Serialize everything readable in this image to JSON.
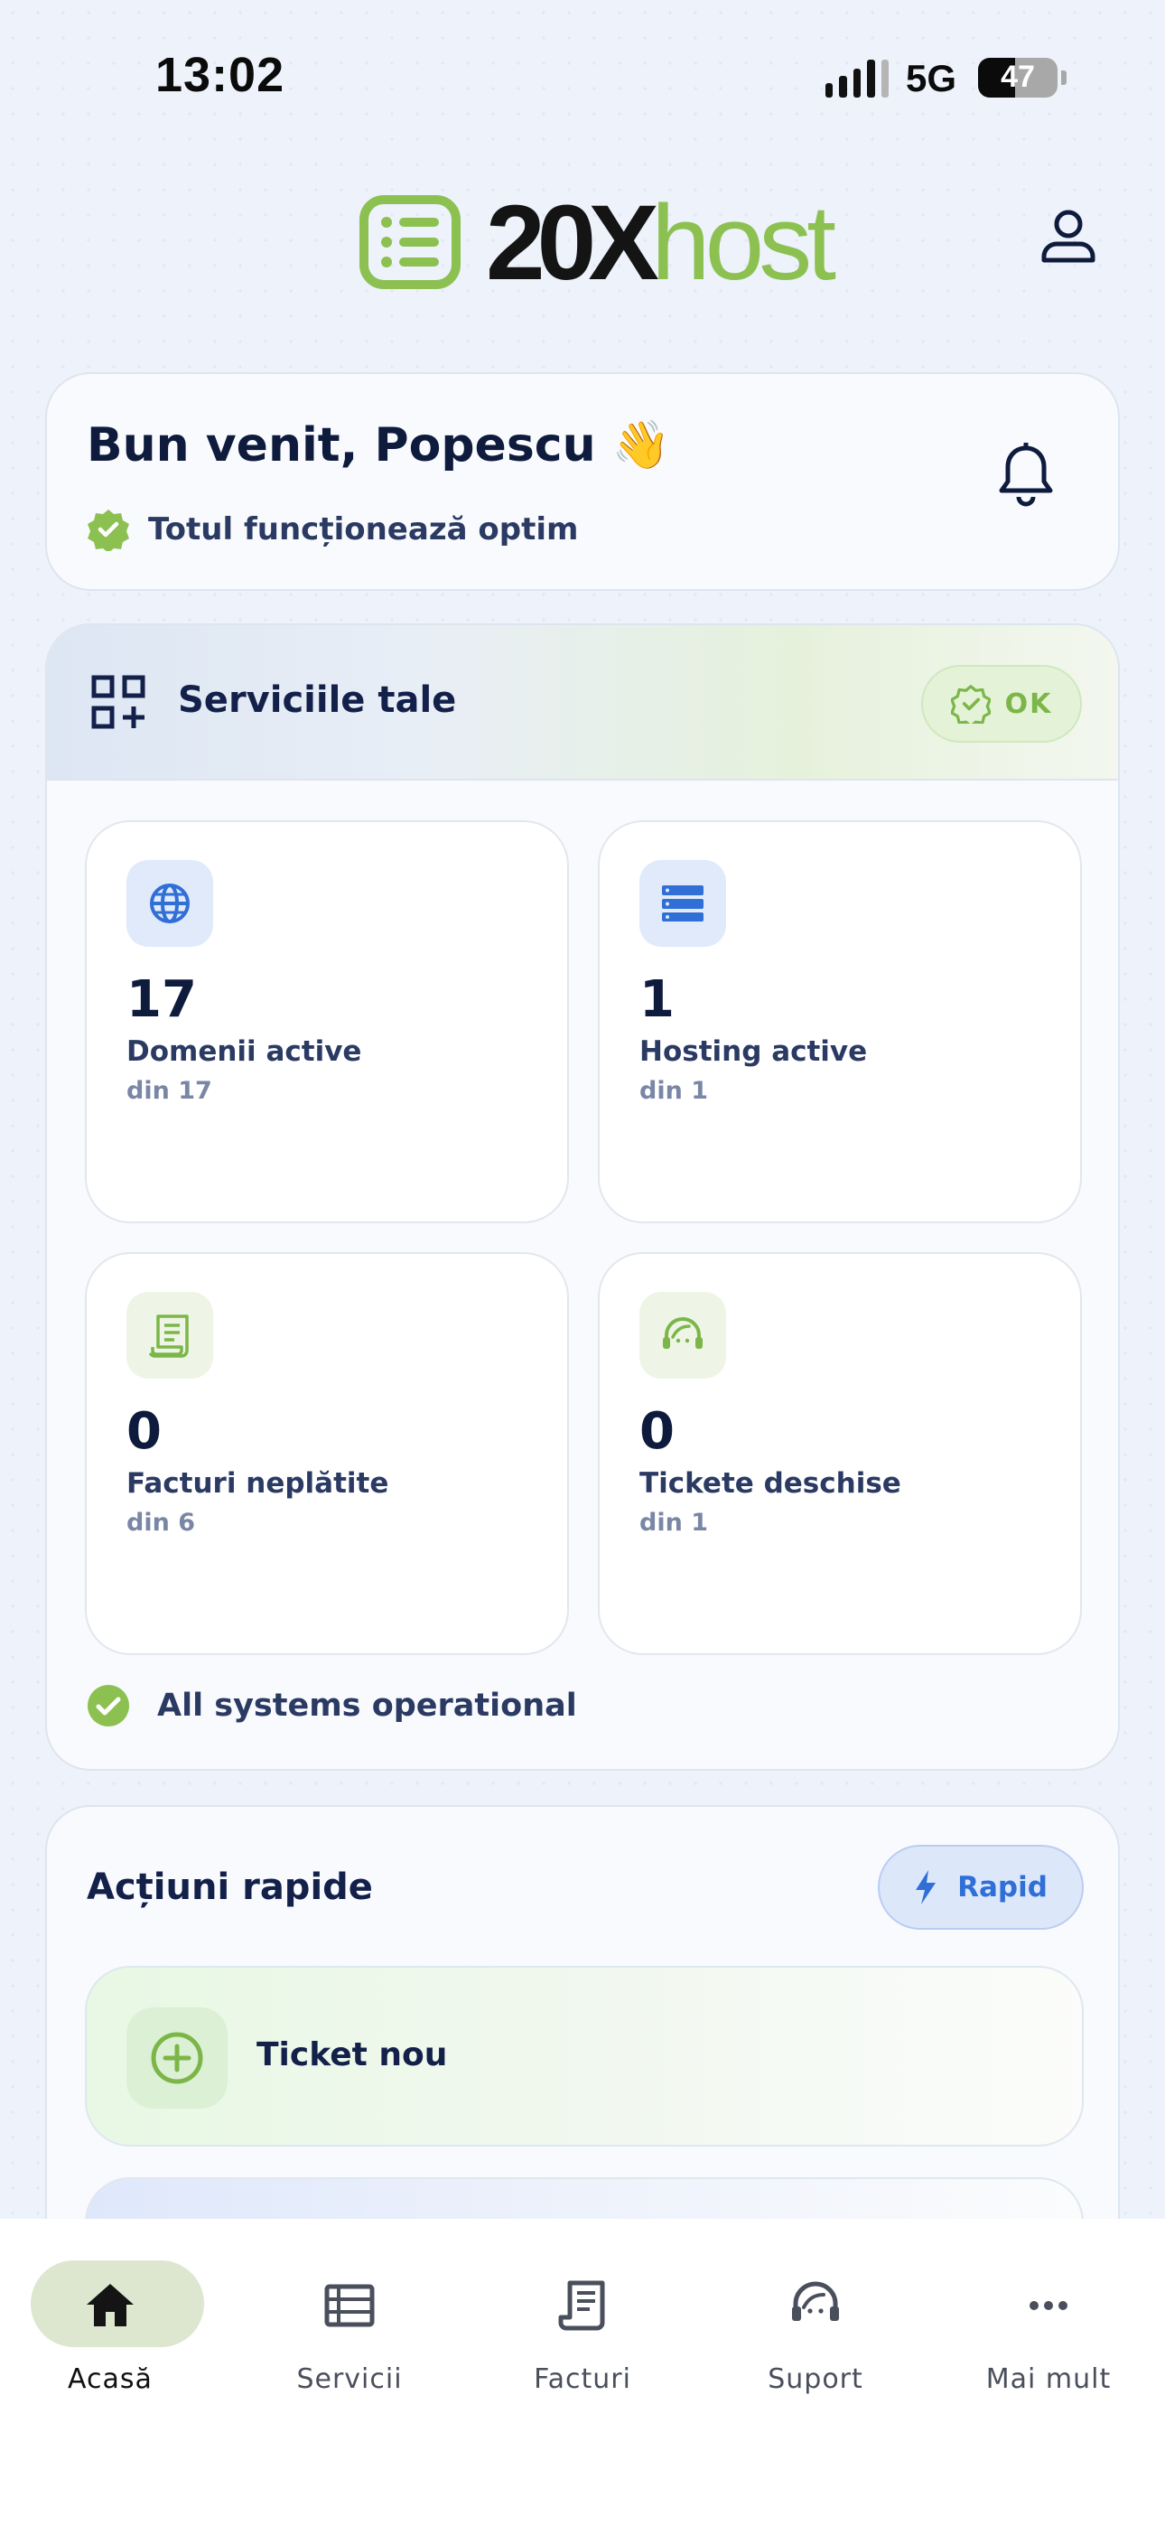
{
  "status_bar": {
    "time": "13:02",
    "network": "5G",
    "battery": "47",
    "battery_level": 0.47
  },
  "header": {
    "logo_dark": "20X",
    "logo_green": "host"
  },
  "welcome": {
    "title": "Bun venit, Popescu 👋",
    "status": "Totul funcționează optim"
  },
  "services": {
    "title": "Serviciile tale",
    "badge": "OK",
    "stats": [
      {
        "value": "17",
        "label": "Domenii active",
        "sub": "din 17",
        "icon": "globe-icon"
      },
      {
        "value": "1",
        "label": "Hosting active",
        "sub": "din 1",
        "icon": "server-icon"
      },
      {
        "value": "0",
        "label": "Facturi neplătite",
        "sub": "din 6",
        "icon": "receipt-icon"
      },
      {
        "value": "0",
        "label": "Tickete deschise",
        "sub": "din 1",
        "icon": "headset-icon"
      }
    ],
    "system_status": "All systems operational"
  },
  "actions": {
    "title": "Acțiuni rapide",
    "badge": "Rapid",
    "items": [
      {
        "label": "Ticket nou",
        "icon": "plus-circle-icon"
      }
    ]
  },
  "nav": {
    "items": [
      {
        "label": "Acasă",
        "icon": "home-icon",
        "active": true
      },
      {
        "label": "Servicii",
        "icon": "list-icon"
      },
      {
        "label": "Facturi",
        "icon": "receipt-icon"
      },
      {
        "label": "Suport",
        "icon": "headset-icon"
      },
      {
        "label": "Mai mult",
        "icon": "more-icon"
      }
    ]
  },
  "colors": {
    "brand_green": "#8cc152",
    "accent_blue": "#2f6fd6",
    "text_dark": "#0f1b3d"
  }
}
